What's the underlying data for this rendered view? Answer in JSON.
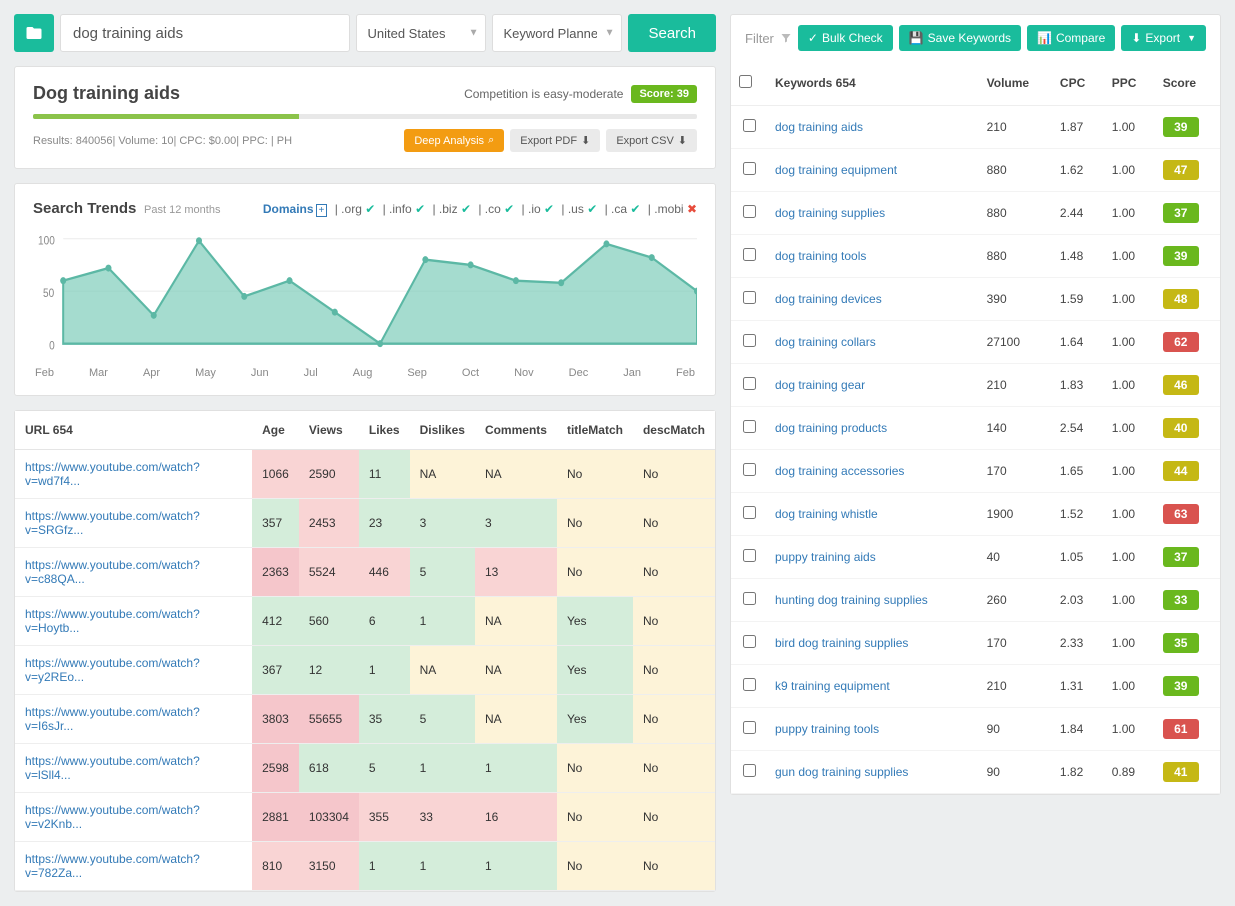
{
  "search": {
    "query": "dog training aids",
    "country": "United States",
    "tool": "Keyword Planner",
    "button": "Search"
  },
  "summary": {
    "title": "Dog training aids",
    "competition_text": "Competition is easy-moderate",
    "score_label": "Score: 39",
    "meta": "Results: 840056| Volume: 10| CPC: $0.00| PPC: | PH",
    "deep_analysis": "Deep Analysis",
    "export_pdf": "Export PDF",
    "export_csv": "Export CSV"
  },
  "trends": {
    "title": "Search Trends",
    "subtitle": "Past 12 months",
    "domains_label": "Domains",
    "tlds": [
      {
        "ext": ".org",
        "ok": true
      },
      {
        "ext": ".info",
        "ok": true
      },
      {
        "ext": ".biz",
        "ok": true
      },
      {
        "ext": ".co",
        "ok": true
      },
      {
        "ext": ".io",
        "ok": true
      },
      {
        "ext": ".us",
        "ok": true
      },
      {
        "ext": ".ca",
        "ok": true
      },
      {
        "ext": ".mobi",
        "ok": false
      }
    ]
  },
  "chart_data": {
    "type": "area",
    "title": "Search Trends",
    "xlabel": "",
    "ylabel": "",
    "ylim": [
      0,
      100
    ],
    "yticks": [
      0,
      50,
      100
    ],
    "categories": [
      "Feb",
      "Mar",
      "Apr",
      "May",
      "Jun",
      "Jul",
      "Aug",
      "Sep",
      "Oct",
      "Nov",
      "Dec",
      "Jan",
      "Feb"
    ],
    "values": [
      60,
      72,
      27,
      98,
      45,
      60,
      30,
      0,
      80,
      75,
      60,
      58,
      95,
      82,
      50
    ]
  },
  "url_table": {
    "headers": [
      "URL  654",
      "Age",
      "Views",
      "Likes",
      "Dislikes",
      "Comments",
      "titleMatch",
      "descMatch"
    ],
    "rows": [
      {
        "url": "https://www.youtube.com/watch?v=wd7f4...",
        "age": "1066",
        "views": "2590",
        "likes": "11",
        "dislikes": "NA",
        "comments": "NA",
        "title": "No",
        "desc": "No"
      },
      {
        "url": "https://www.youtube.com/watch?v=SRGfz...",
        "age": "357",
        "views": "2453",
        "likes": "23",
        "dislikes": "3",
        "comments": "3",
        "title": "No",
        "desc": "No"
      },
      {
        "url": "https://www.youtube.com/watch?v=c88QA...",
        "age": "2363",
        "views": "5524",
        "likes": "446",
        "dislikes": "5",
        "comments": "13",
        "title": "No",
        "desc": "No"
      },
      {
        "url": "https://www.youtube.com/watch?v=Hoytb...",
        "age": "412",
        "views": "560",
        "likes": "6",
        "dislikes": "1",
        "comments": "NA",
        "title": "Yes",
        "desc": "No"
      },
      {
        "url": "https://www.youtube.com/watch?v=y2REo...",
        "age": "367",
        "views": "12",
        "likes": "1",
        "dislikes": "NA",
        "comments": "NA",
        "title": "Yes",
        "desc": "No"
      },
      {
        "url": "https://www.youtube.com/watch?v=I6sJr...",
        "age": "3803",
        "views": "55655",
        "likes": "35",
        "dislikes": "5",
        "comments": "NA",
        "title": "Yes",
        "desc": "No"
      },
      {
        "url": "https://www.youtube.com/watch?v=lSll4...",
        "age": "2598",
        "views": "618",
        "likes": "5",
        "dislikes": "1",
        "comments": "1",
        "title": "No",
        "desc": "No"
      },
      {
        "url": "https://www.youtube.com/watch?v=v2Knb...",
        "age": "2881",
        "views": "103304",
        "likes": "355",
        "dislikes": "33",
        "comments": "16",
        "title": "No",
        "desc": "No"
      },
      {
        "url": "https://www.youtube.com/watch?v=782Za...",
        "age": "810",
        "views": "3150",
        "likes": "1",
        "dislikes": "1",
        "comments": "1",
        "title": "No",
        "desc": "No"
      }
    ]
  },
  "right": {
    "filter": "Filter",
    "bulk_check": "Bulk Check",
    "save_keywords": "Save Keywords",
    "compare": "Compare",
    "export": "Export"
  },
  "kw_table": {
    "headers": {
      "kw": "Keywords 654",
      "vol": "Volume",
      "cpc": "CPC",
      "ppc": "PPC",
      "score": "Score"
    },
    "rows": [
      {
        "kw": "dog training aids",
        "vol": "210",
        "cpc": "1.87",
        "ppc": "1.00",
        "score": "39",
        "c": "green"
      },
      {
        "kw": "dog training equipment",
        "vol": "880",
        "cpc": "1.62",
        "ppc": "1.00",
        "score": "47",
        "c": "yellow"
      },
      {
        "kw": "dog training supplies",
        "vol": "880",
        "cpc": "2.44",
        "ppc": "1.00",
        "score": "37",
        "c": "green"
      },
      {
        "kw": "dog training tools",
        "vol": "880",
        "cpc": "1.48",
        "ppc": "1.00",
        "score": "39",
        "c": "green"
      },
      {
        "kw": "dog training devices",
        "vol": "390",
        "cpc": "1.59",
        "ppc": "1.00",
        "score": "48",
        "c": "yellow"
      },
      {
        "kw": "dog training collars",
        "vol": "27100",
        "cpc": "1.64",
        "ppc": "1.00",
        "score": "62",
        "c": "red"
      },
      {
        "kw": "dog training gear",
        "vol": "210",
        "cpc": "1.83",
        "ppc": "1.00",
        "score": "46",
        "c": "yellow"
      },
      {
        "kw": "dog training products",
        "vol": "140",
        "cpc": "2.54",
        "ppc": "1.00",
        "score": "40",
        "c": "yellow"
      },
      {
        "kw": "dog training accessories",
        "vol": "170",
        "cpc": "1.65",
        "ppc": "1.00",
        "score": "44",
        "c": "yellow"
      },
      {
        "kw": "dog training whistle",
        "vol": "1900",
        "cpc": "1.52",
        "ppc": "1.00",
        "score": "63",
        "c": "red"
      },
      {
        "kw": "puppy training aids",
        "vol": "40",
        "cpc": "1.05",
        "ppc": "1.00",
        "score": "37",
        "c": "green"
      },
      {
        "kw": "hunting dog training supplies",
        "vol": "260",
        "cpc": "2.03",
        "ppc": "1.00",
        "score": "33",
        "c": "green"
      },
      {
        "kw": "bird dog training supplies",
        "vol": "170",
        "cpc": "2.33",
        "ppc": "1.00",
        "score": "35",
        "c": "green"
      },
      {
        "kw": "k9 training equipment",
        "vol": "210",
        "cpc": "1.31",
        "ppc": "1.00",
        "score": "39",
        "c": "green"
      },
      {
        "kw": "puppy training tools",
        "vol": "90",
        "cpc": "1.84",
        "ppc": "1.00",
        "score": "61",
        "c": "red"
      },
      {
        "kw": "gun dog training supplies",
        "vol": "90",
        "cpc": "1.82",
        "ppc": "0.89",
        "score": "41",
        "c": "yellow"
      }
    ]
  }
}
